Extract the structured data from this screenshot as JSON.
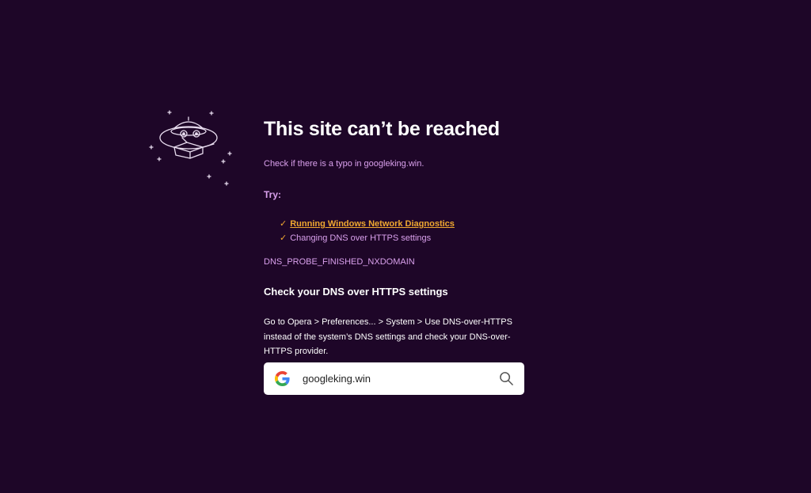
{
  "error_page": {
    "title": "This site can’t be reached",
    "subtitle": "Check if there is a typo in googleking.win.",
    "try_label": "Try:",
    "suggestions": [
      {
        "check": "✓",
        "label": "Running Windows Network Diagnostics",
        "is_link": true
      },
      {
        "check": "✓",
        "label": "Changing DNS over HTTPS settings",
        "is_link": false
      }
    ],
    "error_code": "DNS_PROBE_FINISHED_NXDOMAIN",
    "dns_heading": "Check your DNS over HTTPS settings",
    "dns_body": "Go to Opera > Preferences... > System > Use DNS-over-HTTPS instead of the system’s DNS settings and check your DNS-over-HTTPS provider."
  },
  "search": {
    "engine_icon": "google-logo-icon",
    "value": "googleking.win",
    "action_icon": "search-icon"
  },
  "illustration": {
    "icon": "ufo-icon"
  },
  "colors": {
    "background": "#1e0628",
    "accent_text": "#d9a0ec",
    "link": "#f0a830",
    "heading": "#ffffff"
  }
}
